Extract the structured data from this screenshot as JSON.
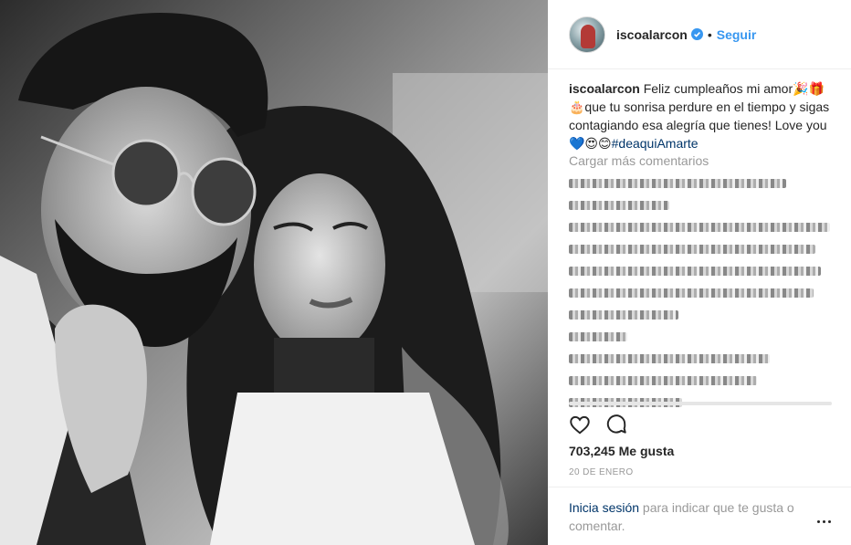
{
  "post": {
    "username": "iscoalarcon",
    "verified_icon": "verified-badge-icon",
    "follow_label": "Seguir",
    "separator": "•"
  },
  "caption": {
    "username": "iscoalarcon",
    "line1": "Feliz cumpleaños mi amor🎉🎁🎂que tu sonrisa perdure en el tiempo y sigas contagiando esa alegría que tienes! Love you💙😍😊",
    "hashtag": "#deaquiAmarte"
  },
  "comments": {
    "load_more_label": "Cargar más comentarios"
  },
  "stats": {
    "likes_count": "703,245",
    "likes_label": "Me gusta",
    "date": "20 DE ENERO"
  },
  "footer": {
    "login_link": "Inicia sesión",
    "login_text": " para indicar que te gusta o comentar."
  },
  "colors": {
    "accent": "#3897f0",
    "link_dark": "#003569",
    "muted": "#999999"
  }
}
